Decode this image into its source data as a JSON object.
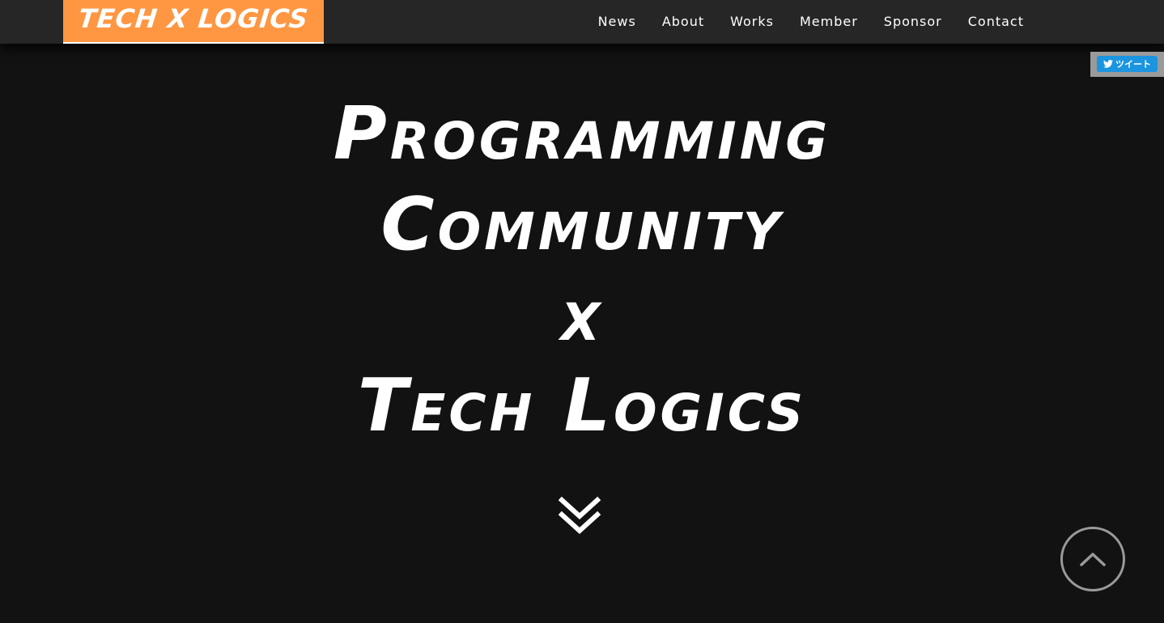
{
  "header": {
    "logo_text": "TECH X LOGICS",
    "nav": [
      {
        "label": "News"
      },
      {
        "label": "About"
      },
      {
        "label": "Works"
      },
      {
        "label": "Member"
      },
      {
        "label": "Sponsor"
      },
      {
        "label": "Contact"
      }
    ]
  },
  "share": {
    "tweet_label": "ツイート",
    "icon": "twitter-bird-icon"
  },
  "hero": {
    "lines": [
      "Programming",
      "Community",
      "x",
      "Tech Logics"
    ]
  },
  "icons": {
    "scroll_down": "double-chevron-down-icon",
    "back_to_top": "chevron-up-icon"
  },
  "colors": {
    "accent": "#fe9642",
    "header_bg": "#262626",
    "page_bg": "#121212",
    "tweet_blue": "#1b95e0"
  }
}
